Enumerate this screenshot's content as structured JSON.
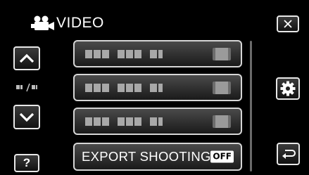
{
  "header": {
    "title": "VIDEO",
    "mode_icon": "video-camera-icon"
  },
  "nav": {
    "up_icon": "chevron-up-icon",
    "down_icon": "chevron-down-icon",
    "page_indicator_icon": "page-indicator-icon",
    "help_label": "?"
  },
  "controls": {
    "close_icon": "close-icon",
    "settings_icon": "gear-icon",
    "back_icon": "return-icon"
  },
  "menu": {
    "items": [
      {
        "label": "",
        "value": ""
      },
      {
        "label": "",
        "value": ""
      },
      {
        "label": "",
        "value": ""
      },
      {
        "label": "EXPORT SHOOTING",
        "value": "OFF"
      }
    ]
  },
  "colors": {
    "background": "#000000",
    "text": "#ffffff",
    "border": "#e8e8e8"
  }
}
